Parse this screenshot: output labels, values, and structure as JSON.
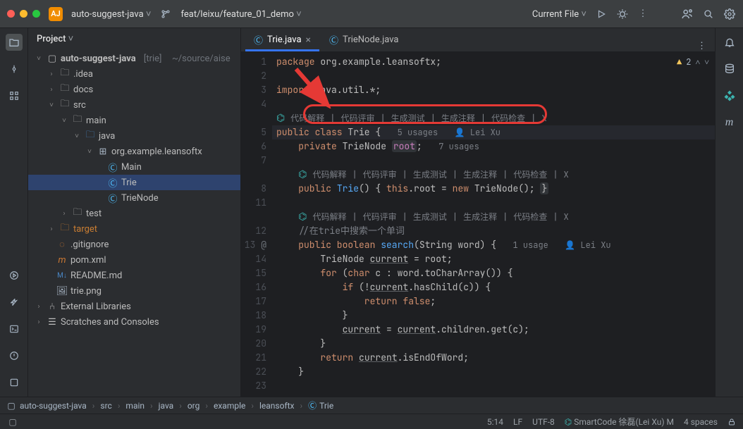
{
  "toolbar": {
    "project_badge": "AJ",
    "project_name": "auto-suggest-java",
    "branch": "feat/leixu/feature_01_demo",
    "run_config": "Current File"
  },
  "project_pane": {
    "title": "Project",
    "root": {
      "name": "auto-suggest-java",
      "tag": "[trie]",
      "path": "~/source/aise"
    },
    "items": {
      "idea": ".idea",
      "docs": "docs",
      "src": "src",
      "main": "main",
      "java": "java",
      "pkg": "org.example.leansoftx",
      "main_cls": "Main",
      "trie_cls": "Trie",
      "trienode_cls": "TrieNode",
      "test": "test",
      "target": "target",
      "gitignore": ".gitignore",
      "pom": "pom.xml",
      "readme": "README.md",
      "triepng": "trie.png",
      "ext_libs": "External Libraries",
      "scratches": "Scratches and Consoles"
    }
  },
  "tabs": {
    "active": "Trie.java",
    "other": "TrieNode.java"
  },
  "problems": {
    "warnings": "2"
  },
  "gutter": [
    "1",
    "2",
    "3",
    "4",
    "",
    "5",
    "6",
    "7",
    "",
    "8",
    "11",
    "",
    "12",
    "13",
    "14",
    "15",
    "16",
    "17",
    "18",
    "19",
    "20",
    "21",
    "22",
    "23"
  ],
  "gutter_mark_line13": "@",
  "code": {
    "l1": "package",
    "l1b": " org.example.leansoftx;",
    "l3a": "import",
    "l3b": " java.util.*;",
    "lens_items": [
      "代码解释",
      "代码评审",
      "生成测试",
      "生成注释",
      "代码检查",
      "X"
    ],
    "l5a": "public class ",
    "l5b": "Trie",
    "l5c": " {",
    "l5u": "5 usages",
    "l5au": "Lei Xu",
    "l6a": "    private ",
    "l6b": "TrieNode ",
    "l6c": "root",
    "l6d": ";",
    "l6u": "7 usages",
    "l8a": "    public ",
    "l8b": "Trie",
    "l8c": "() { ",
    "l8d": "this",
    "l8e": ".root = ",
    "l8f": "new ",
    "l8g": "TrieNode(); ",
    "l8h": "}",
    "l12": "    //在trie中搜索一个单词",
    "l13a": "    public boolean ",
    "l13b": "search",
    "l13c": "(String word) {",
    "l13u": "1 usage",
    "l13au": "Lei Xu",
    "l14a": "        TrieNode ",
    "l14b": "current",
    "l14c": " = root;",
    "l15a": "        for ",
    "l15b": "(",
    "l15c": "char",
    "l15d": " c : word.toCharArray()) {",
    "l16a": "            if ",
    "l16b": "(!",
    "l16c": "current",
    "l16d": ".hasChild(c)) {",
    "l17a": "                return false",
    "l17b": ";",
    "l18": "            }",
    "l19a": "            ",
    "l19b": "current",
    "l19c": " = ",
    "l19d": "current",
    "l19e": ".children.get(c);",
    "l20": "        }",
    "l21a": "        return ",
    "l21b": "current",
    "l21c": ".isEndOfWord;",
    "l22": "    }"
  },
  "breadcrumb": [
    "auto-suggest-java",
    "src",
    "main",
    "java",
    "org",
    "example",
    "leansoftx",
    "Trie"
  ],
  "status": {
    "caret": "5:14",
    "lf": "LF",
    "enc": "UTF-8",
    "smart": "SmartCode 徐磊(Lei Xu) M",
    "indent": "4 spaces"
  }
}
